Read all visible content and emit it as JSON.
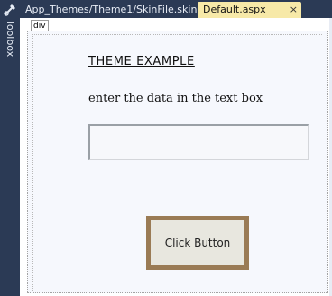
{
  "toolbox": {
    "label": "Toolbox",
    "icon": "toolbox-icon"
  },
  "tabs": [
    {
      "label": "App_Themes/Theme1/SkinFile.skin",
      "active": false
    },
    {
      "label": "Default.aspx",
      "active": true,
      "close": "×"
    }
  ],
  "designer": {
    "element_tag": "div",
    "title": "THEME EXAMPLE",
    "instruction": "enter the data in the text box",
    "textbox_value": "",
    "button_label": "Click Button"
  },
  "colors": {
    "chrome": "#2b3a55",
    "active_tab": "#f7e9a8",
    "button_border": "#9a7b55",
    "button_face": "#e8e7df"
  }
}
